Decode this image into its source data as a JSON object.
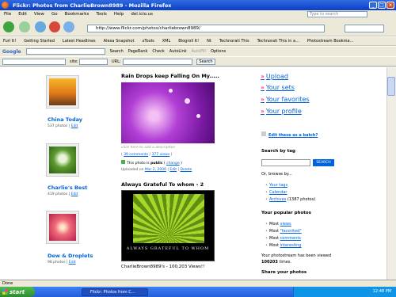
{
  "window": {
    "title": "Flickr: Photos from CharlieBrown8989 - Mozilla Firefox"
  },
  "menu": [
    "File",
    "Edit",
    "View",
    "Go",
    "Bookmarks",
    "Tools",
    "Help",
    "del.icio.us"
  ],
  "toolbar": {
    "url": "http://www.flickr.com/photos/charliebrown8989/",
    "tag_search_placeholder": "Type to search"
  },
  "bookmarks": [
    "Furl It!",
    "Getting Started",
    "Latest Headlines",
    "Alexa Snapshot",
    "xTools",
    "XML",
    "Blogroll It!",
    "Nt",
    "Technorati This",
    "Technorati This in a...",
    "Photostream Bookma..."
  ],
  "google_toolbar": {
    "brand": "Google",
    "items": [
      "Search",
      "PageRank",
      "Check",
      "AutoLink",
      "AutoFill",
      "Options"
    ],
    "pagerank_label": "PageRank"
  },
  "ctrl_bar": {
    "site_label": "site:",
    "url_label": "URL:",
    "search_button": "Search"
  },
  "sets": [
    {
      "title": "China Today",
      "photos": "537 photos",
      "edit": "Edit"
    },
    {
      "title": "Charlie's Best",
      "photos": "419 photos",
      "edit": "Edit"
    },
    {
      "title": "Dew & Droplets",
      "photos": "98 photos",
      "edit": "Edit"
    }
  ],
  "photos": [
    {
      "title": "Rain Drops keep Falling On My.....",
      "add_desc": "click here to add a description",
      "comments": "39 comments",
      "views": "377 views",
      "public_prefix": "This photo is ",
      "public_word": "public",
      "public_change": "change",
      "uploaded_prefix": "Uploaded on ",
      "uploaded_date": "Mar 2, 2006",
      "edit": "Edit",
      "delete": "Delete"
    },
    {
      "title": "Always Grateful To whom - 2",
      "caption_big": "ALWAYS GRATEFUL TO WHOM",
      "caption_small": "CharlieBrown8989's - 100,203 Views!!"
    }
  ],
  "right": {
    "nav": [
      "Upload",
      "Your sets",
      "Your favorites",
      "Your profile"
    ],
    "edit_batch": "Edit these as a batch?",
    "search_by_tag": "Search by tag",
    "search_button": "SEARCH",
    "browse_by": "Or, browse by...",
    "browse_links": [
      "Your tags",
      "Calendar",
      "Archives"
    ],
    "archives_count": "(1387 photos)",
    "popular_title": "Your popular photos",
    "popular": [
      {
        "prefix": "Most ",
        "word": "views"
      },
      {
        "prefix": "Most ",
        "word": "\"favorited\""
      },
      {
        "prefix": "Most ",
        "word": "comments"
      },
      {
        "prefix": "Most ",
        "word": "interesting"
      }
    ],
    "viewed_text": "Your photostream has been viewed",
    "viewed_count": "100203",
    "viewed_suffix": "times.",
    "share_title": "Share your photos"
  },
  "status": {
    "text": "Done"
  },
  "taskbar": {
    "start": "start",
    "task": "Flickr: Photos from C...",
    "clock": "12:48 PM"
  }
}
